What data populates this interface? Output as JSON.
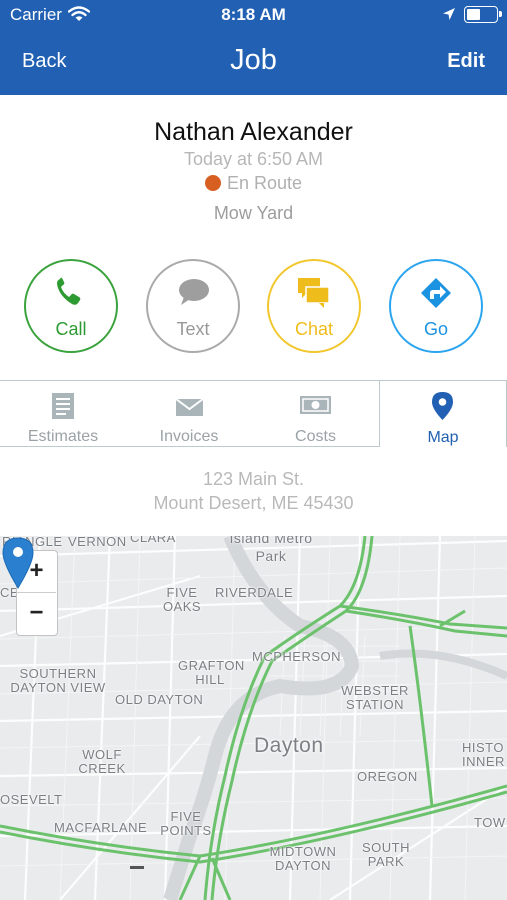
{
  "status_bar": {
    "carrier": "Carrier",
    "time": "8:18 AM"
  },
  "nav": {
    "back": "Back",
    "title": "Job",
    "edit": "Edit"
  },
  "customer": {
    "name": "Nathan Alexander",
    "appointment": "Today at 6:50 AM",
    "status": "En Route",
    "status_color": "#d85f22",
    "job_type": "Mow Yard"
  },
  "actions": [
    {
      "label": "Call",
      "icon": "phone-icon",
      "color": "#3aa33d"
    },
    {
      "label": "Text",
      "icon": "speech-bubble-icon",
      "color": "#aaaaaa"
    },
    {
      "label": "Chat",
      "icon": "chat-bubbles-icon",
      "color": "#f2c72d"
    },
    {
      "label": "Go",
      "icon": "directions-icon",
      "color": "#2ba5ef"
    }
  ],
  "tabs": [
    {
      "label": "Estimates",
      "icon": "document-icon"
    },
    {
      "label": "Invoices",
      "icon": "envelope-icon"
    },
    {
      "label": "Costs",
      "icon": "cash-icon"
    },
    {
      "label": "Map",
      "icon": "map-pin-icon",
      "active": true
    }
  ],
  "address": {
    "line1": "123 Main St.",
    "line2": "Mount Desert, ME 45430"
  },
  "map": {
    "zoom_in": "+",
    "zoom_out": "−",
    "city": "Dayton",
    "labels": [
      "RIANGLE",
      "VERNON",
      "CLARA",
      "Island Metro Park",
      "FIVE OAKS",
      "RIVERDALE",
      "CE",
      "SOUTHERN DAYTON VIEW",
      "GRAFTON HILL",
      "MCPHERSON",
      "OLD DAYTON",
      "WEBSTER STATION",
      "WOLF CREEK",
      "OREGON",
      "HISTO INNER",
      "OSEVELT",
      "MACFARLANE",
      "FIVE POINTS",
      "SOUTH PARK",
      "MIDTOWN DAYTON",
      "TOW"
    ]
  }
}
